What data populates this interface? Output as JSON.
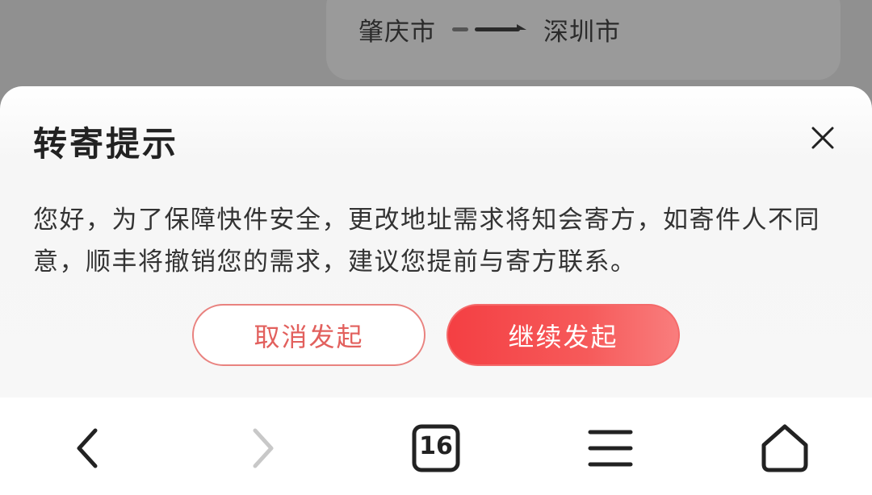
{
  "route": {
    "from": "肇庆市",
    "to": "深圳市"
  },
  "dialog": {
    "title": "转寄提示",
    "message": "您好，为了保障快件安全，更改地址需求将知会寄方，如寄件人不同意，顺丰将撤销您的需求，建议您提前与寄方联系。",
    "cancel_label": "取消发起",
    "continue_label": "继续发起"
  },
  "navbar": {
    "tab_count": "16",
    "icons": [
      "back-icon",
      "forward-icon",
      "tabs-icon",
      "menu-icon",
      "home-icon"
    ]
  },
  "colors": {
    "accent": "#f44747",
    "cancel_text": "#e2605d",
    "backdrop": "#909090"
  }
}
